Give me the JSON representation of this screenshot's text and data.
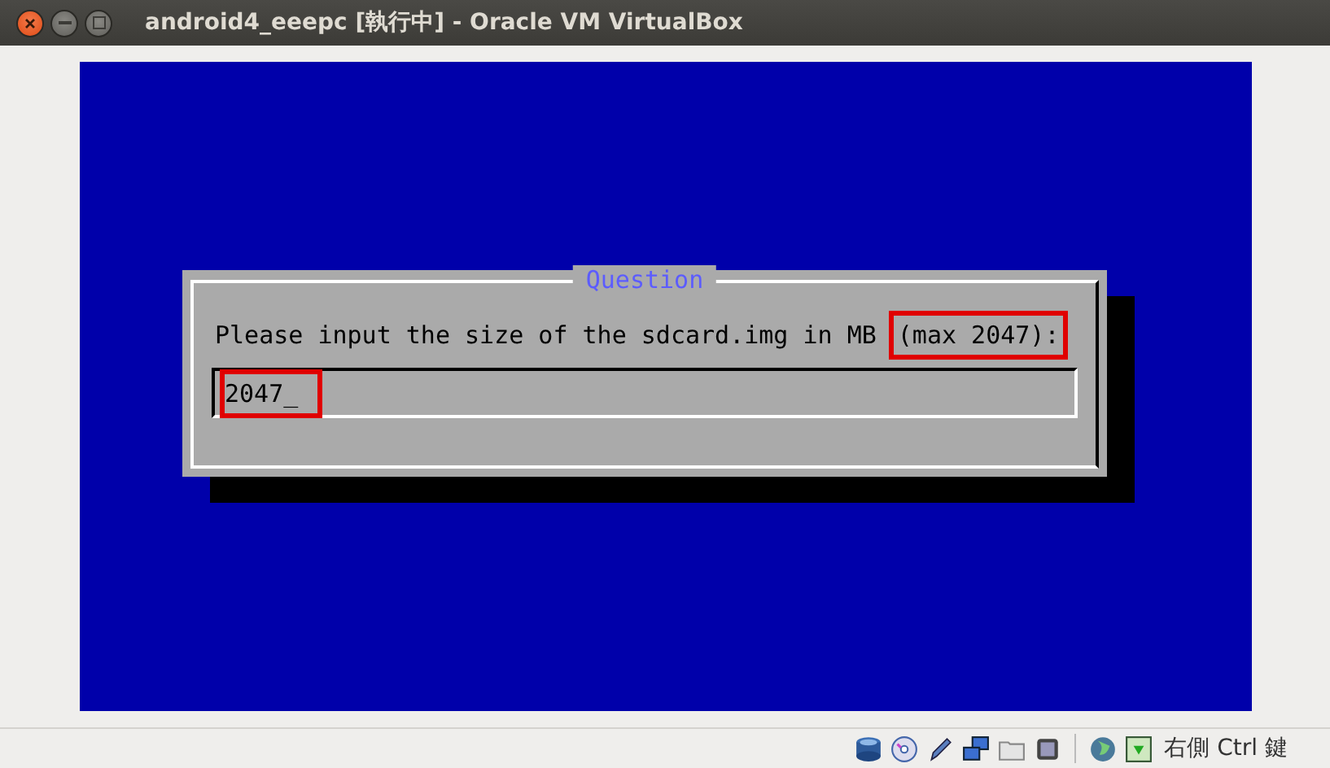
{
  "window": {
    "title": "android4_eeepc [執行中] - Oracle VM VirtualBox"
  },
  "dialog": {
    "title": "Question",
    "prompt": [
      {
        "text": "Please input the size of the sdcard.img in MB",
        "highlighted": false
      },
      {
        "text": "(max 2047):",
        "highlighted": true
      }
    ],
    "input": {
      "value": "2047_",
      "highlighted": true
    }
  },
  "status_bar": {
    "host_key": "右側 Ctrl 鍵"
  }
}
